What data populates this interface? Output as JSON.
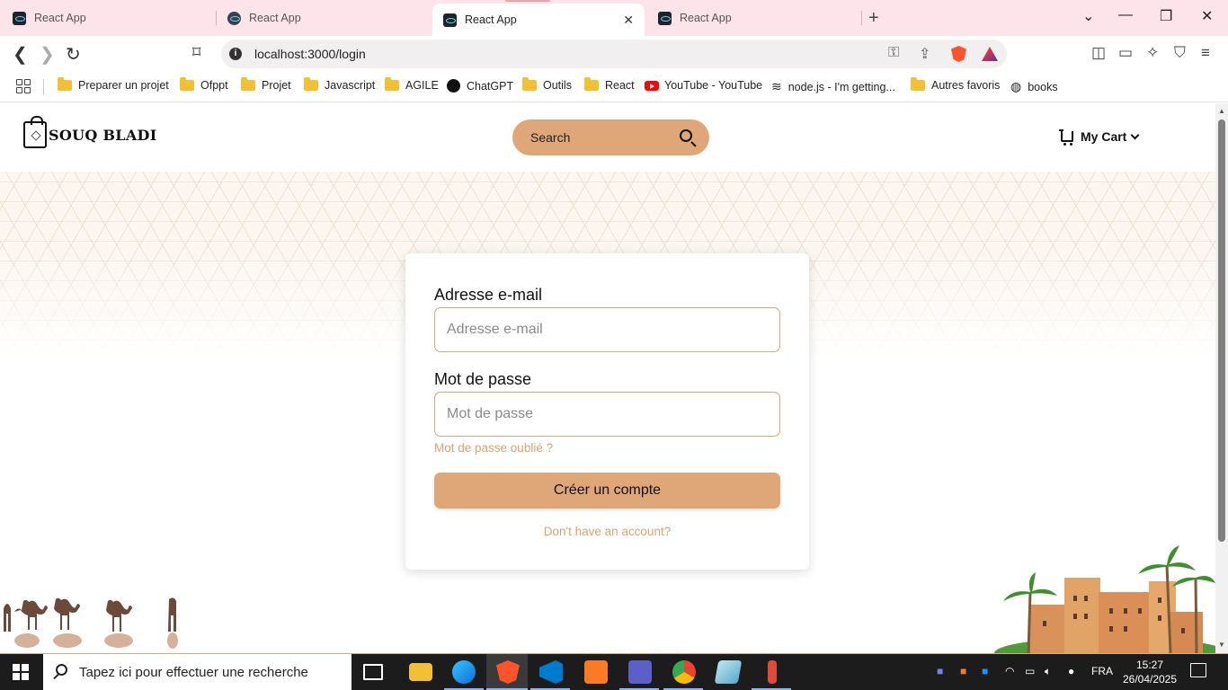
{
  "browser": {
    "tabs": [
      {
        "title": "React App"
      },
      {
        "title": "React App"
      },
      {
        "title": "React App",
        "active": true
      },
      {
        "title": "React App"
      }
    ],
    "new_tab": "+",
    "url": "localhost:3000/login",
    "bookmarks": [
      "Preparer un projet",
      "Ofppt",
      "Projet",
      "Javascript",
      "AGILE",
      "ChatGPT",
      "Outils",
      "React",
      "YouTube - YouTube",
      "node.js - I'm getting...",
      "Autres favoris",
      "books"
    ]
  },
  "site": {
    "logo_text": "SOUQ BLADI",
    "search_placeholder": "Search",
    "cart_label": "My Cart"
  },
  "login": {
    "email_label": "Adresse e-mail",
    "email_placeholder": "Adresse e-mail",
    "password_label": "Mot de passe",
    "password_placeholder": "Mot de passe",
    "forgot_link": "Mot de passe oublié ?",
    "submit_label": "Créer un compte",
    "signup_link": "Don't have an account?"
  },
  "taskbar": {
    "search_text": "Tapez ici pour effectuer une recherche",
    "language": "FRA",
    "time": "15:27",
    "date": "26/04/2025"
  },
  "colors": {
    "accent": "#dfa677",
    "link": "#d9a274",
    "tabstrip": "#fce4ea"
  }
}
